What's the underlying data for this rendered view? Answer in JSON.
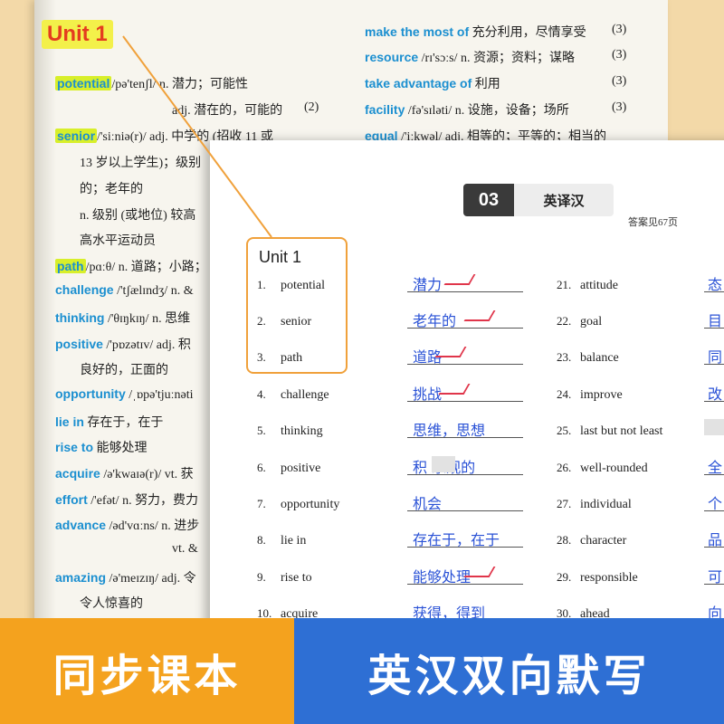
{
  "back_page": {
    "unit_title": "Unit 1",
    "left_entries": [
      {
        "word": "potential",
        "rest": "/pə'tenʃl/ n. 潜力；可能性"
      },
      {
        "word": "senior",
        "rest": "/'siːniə(r)/ adj. 中学的 (招收 11 或"
      },
      {
        "word": "path",
        "rest": "/pɑːθ/ n. 道路；小路；"
      },
      {
        "word": "challenge",
        "rest": "/'tʃælɪndʒ/ n. &"
      },
      {
        "word": "thinking",
        "rest": "/'θɪŋkɪŋ/ n. 思维"
      },
      {
        "word": "positive",
        "rest": "/'pɒzətɪv/ adj. 积"
      },
      {
        "word": "opportunity",
        "rest": "/ˌɒpə'tjuːnəti"
      },
      {
        "word": "lie in",
        "rest": "存在于，在于"
      },
      {
        "word": "rise to",
        "rest": "能够处理"
      },
      {
        "word": "acquire",
        "rest": "/ə'kwaɪə(r)/ vt. 获"
      },
      {
        "word": "effort",
        "rest": "/'efət/ n. 努力，费力"
      },
      {
        "word": "advance",
        "rest": "/əd'vɑːns/ n. 进步"
      },
      {
        "word": "amazing",
        "rest": "/ə'meɪzɪŋ/ adj. 令"
      }
    ],
    "sub_lines": {
      "potential_adj": "adj. 潜在的，可能的",
      "potential_num": "(2)",
      "senior_2": "13 岁以上学生)；级别",
      "senior_3": "的；老年的",
      "senior_4": "n. 级别 (或地位) 较高",
      "senior_5": "高水平运动员",
      "positive_2": "良好的，正面的",
      "advance_2": "vt. &",
      "amazing_2": "令人惊喜的"
    },
    "right_entries": [
      {
        "word": "make the most of",
        "rest": "充分利用，尽情享受",
        "num": "(3)"
      },
      {
        "word": "resource",
        "rest": "/rɪ'sɔːs/ n. 资源；资料；谋略",
        "num": "(3)"
      },
      {
        "word": "take advantage of",
        "rest": "利用",
        "num": "(3)"
      },
      {
        "word": "facility",
        "rest": "/fə'sɪləti/ n. 设施，设备；场所",
        "num": "(3)"
      },
      {
        "word": "equal",
        "rest": "/'iːkwəl/ adj. 相等的；平等的；相当的",
        "num": ""
      }
    ]
  },
  "worksheet": {
    "badge_num": "03",
    "badge_label": "英译汉",
    "answer_ref": "答案见67页",
    "unit_box_title": "Unit 1",
    "left_items": [
      {
        "n": "1.",
        "word": "potential",
        "answer": "潜力"
      },
      {
        "n": "2.",
        "word": "senior",
        "answer": "老年的"
      },
      {
        "n": "3.",
        "word": "path",
        "answer": "道路"
      },
      {
        "n": "4.",
        "word": "challenge",
        "answer": "挑战"
      },
      {
        "n": "5.",
        "word": "thinking",
        "answer": "思维，思想"
      },
      {
        "n": "6.",
        "word": "positive",
        "answer": "积  乐观的"
      },
      {
        "n": "7.",
        "word": "opportunity",
        "answer": "机会"
      },
      {
        "n": "8.",
        "word": "lie in",
        "answer": "存在于，在于"
      },
      {
        "n": "9.",
        "word": "rise to",
        "answer": "能够处理"
      },
      {
        "n": "10.",
        "word": "acquire",
        "answer": "获得，得到"
      }
    ],
    "right_items": [
      {
        "n": "21.",
        "word": "attitude",
        "answer": "态"
      },
      {
        "n": "22.",
        "word": "goal",
        "answer": "目"
      },
      {
        "n": "23.",
        "word": "balance",
        "answer": "同"
      },
      {
        "n": "24.",
        "word": "improve",
        "answer": "改"
      },
      {
        "n": "25.",
        "word": "last but not least",
        "answer": ""
      },
      {
        "n": "26.",
        "word": "well-rounded",
        "answer": "全"
      },
      {
        "n": "27.",
        "word": "individual",
        "answer": "个"
      },
      {
        "n": "28.",
        "word": "character",
        "answer": "品"
      },
      {
        "n": "29.",
        "word": "responsible",
        "answer": "可"
      },
      {
        "n": "30.",
        "word": "ahead",
        "answer": "向"
      }
    ]
  },
  "banner": {
    "left_text": "同步课本",
    "right_text": "英汉双向默写"
  },
  "colors": {
    "accent_orange": "#f4a21e",
    "accent_blue": "#2e6fd4",
    "word_blue": "#1b8fd0",
    "highlight_yellow": "#d8ef2a",
    "unit_red": "#e43c1f",
    "handwriting_blue": "#2a52d6",
    "check_red": "#e0354a"
  }
}
